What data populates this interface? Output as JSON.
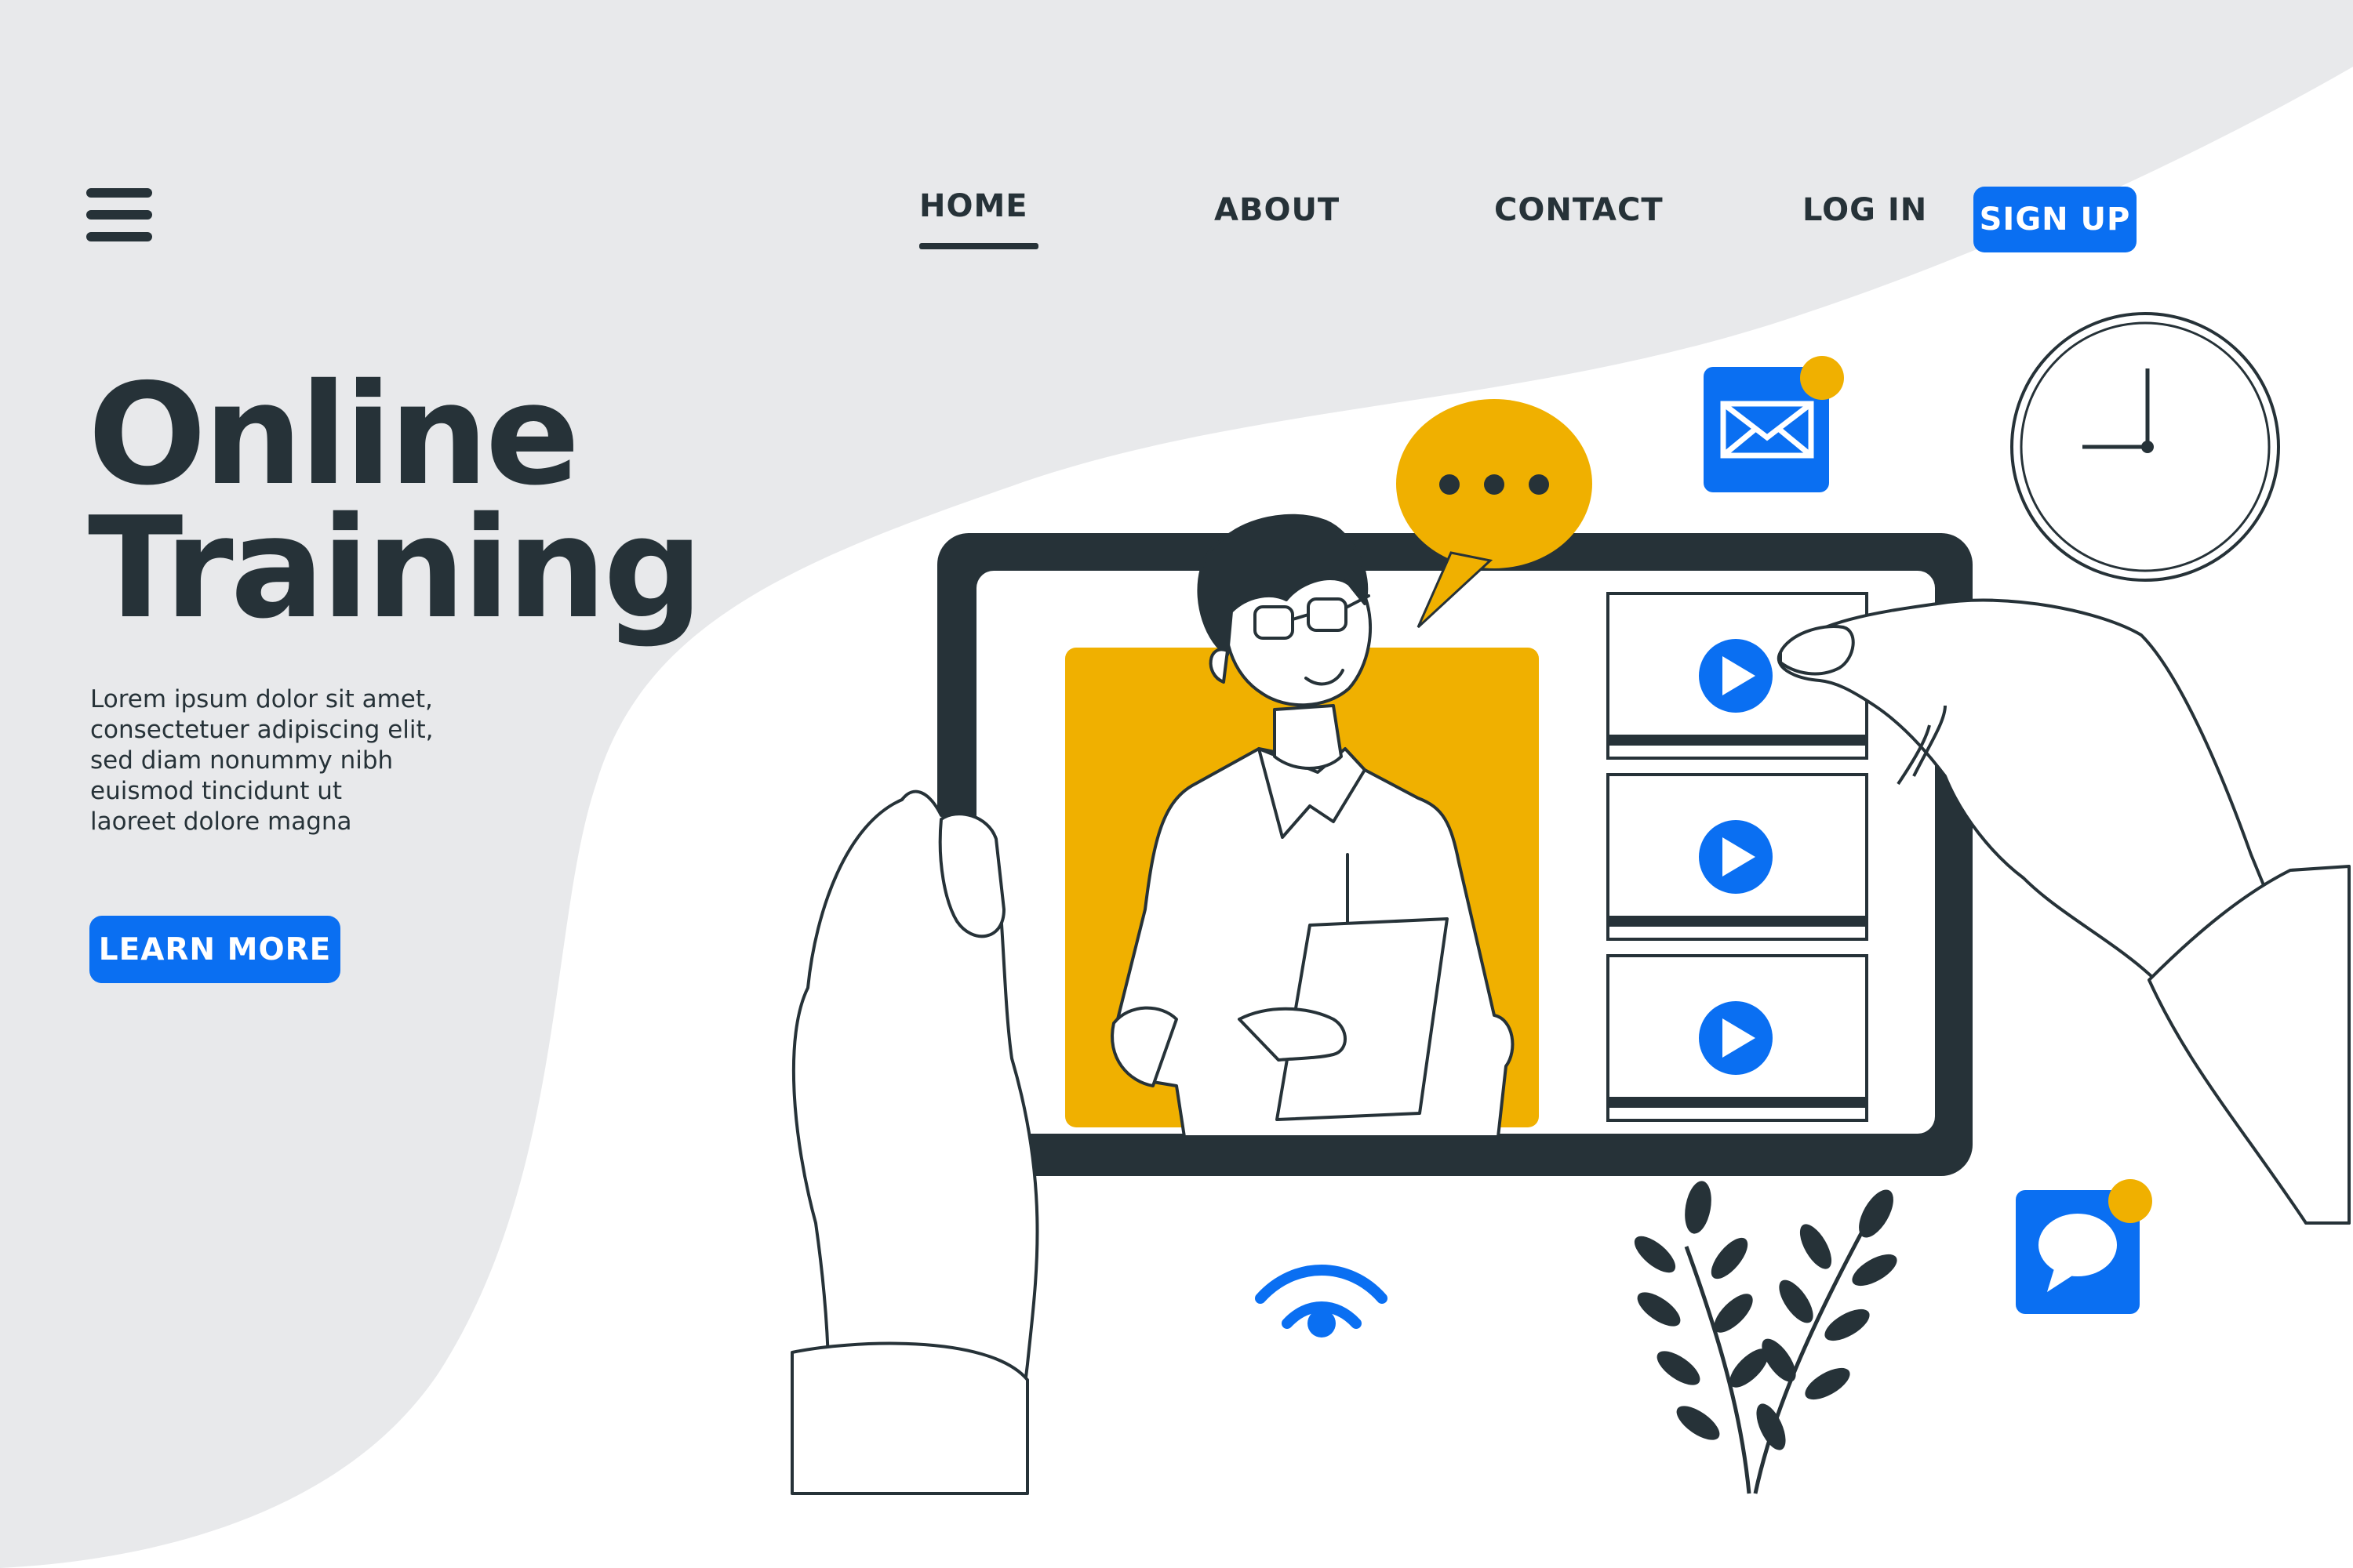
{
  "nav": {
    "menu_icon": "hamburger-menu-icon",
    "items": [
      {
        "label": "HOME",
        "active": true
      },
      {
        "label": "ABOUT",
        "active": false
      },
      {
        "label": "CONTACT",
        "active": false
      },
      {
        "label": "LOG IN",
        "active": false
      }
    ],
    "signup_label": "SIGN UP"
  },
  "hero": {
    "title_line1": "Online",
    "title_line2": "Training",
    "body_lines": [
      "Lorem ipsum dolor sit amet,",
      "consectetuer adipiscing elit,",
      "sed diam nonummy nibh",
      "euismod tincidunt ut",
      "laoreet dolore magna"
    ],
    "cta_label": "LEARN MORE"
  },
  "illustration": {
    "icons": [
      "tablet-icon",
      "chat-bubble-icon",
      "mail-icon",
      "clock-icon",
      "play-icon",
      "wifi-icon",
      "message-icon",
      "plant-icon"
    ],
    "video_items_count": 3
  },
  "colors": {
    "primary_blue": "#0a6ff2",
    "accent_yellow": "#f0b000",
    "dark": "#263238",
    "light_gray": "#e8e9eb"
  }
}
